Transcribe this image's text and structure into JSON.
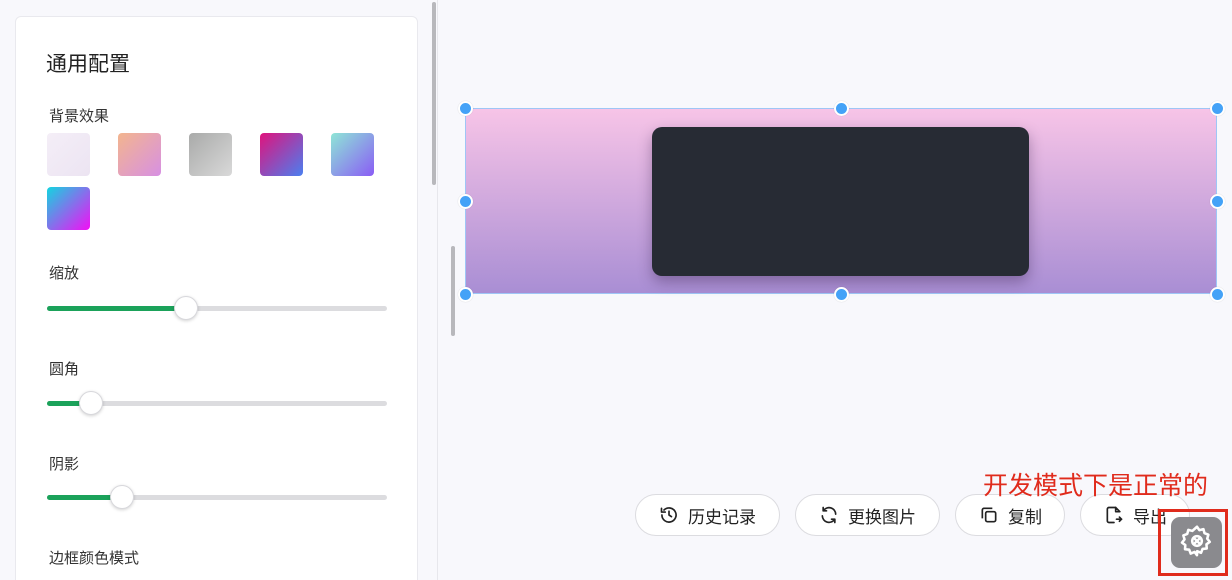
{
  "panel": {
    "title": "通用配置",
    "background_label": "背景效果",
    "backgrounds": [
      {
        "name": "soft-lavender",
        "colors": [
          "#f4eef7",
          "#ece4f2"
        ]
      },
      {
        "name": "peach-pink",
        "colors": [
          "#f3b58e",
          "#d790e3"
        ]
      },
      {
        "name": "gray",
        "colors": [
          "#a9aaa9",
          "#d9d9d9"
        ]
      },
      {
        "name": "magenta-blue",
        "colors": [
          "#e0137c",
          "#4a7ff0"
        ]
      },
      {
        "name": "aqua-purple",
        "colors": [
          "#8ee6d6",
          "#8a5cf5"
        ]
      },
      {
        "name": "cyan-magenta",
        "colors": [
          "#12d6e0",
          "#f40ef5"
        ]
      }
    ],
    "scale": {
      "label": "缩放",
      "value": 0.41
    },
    "radius": {
      "label": "圆角",
      "value": 0.13
    },
    "shadow": {
      "label": "阴影",
      "value": 0.22
    },
    "border_color_label": "边框颜色模式"
  },
  "toolbar": {
    "history_label": "历史记录",
    "replace_label": "更换图片",
    "copy_label": "复制",
    "export_label": "导出"
  },
  "annotation": "开发模式下是正常的",
  "colors": {
    "accent_slider": "#1ba25a",
    "handle": "#44a2f7",
    "annotation_red": "#e02b1c"
  }
}
